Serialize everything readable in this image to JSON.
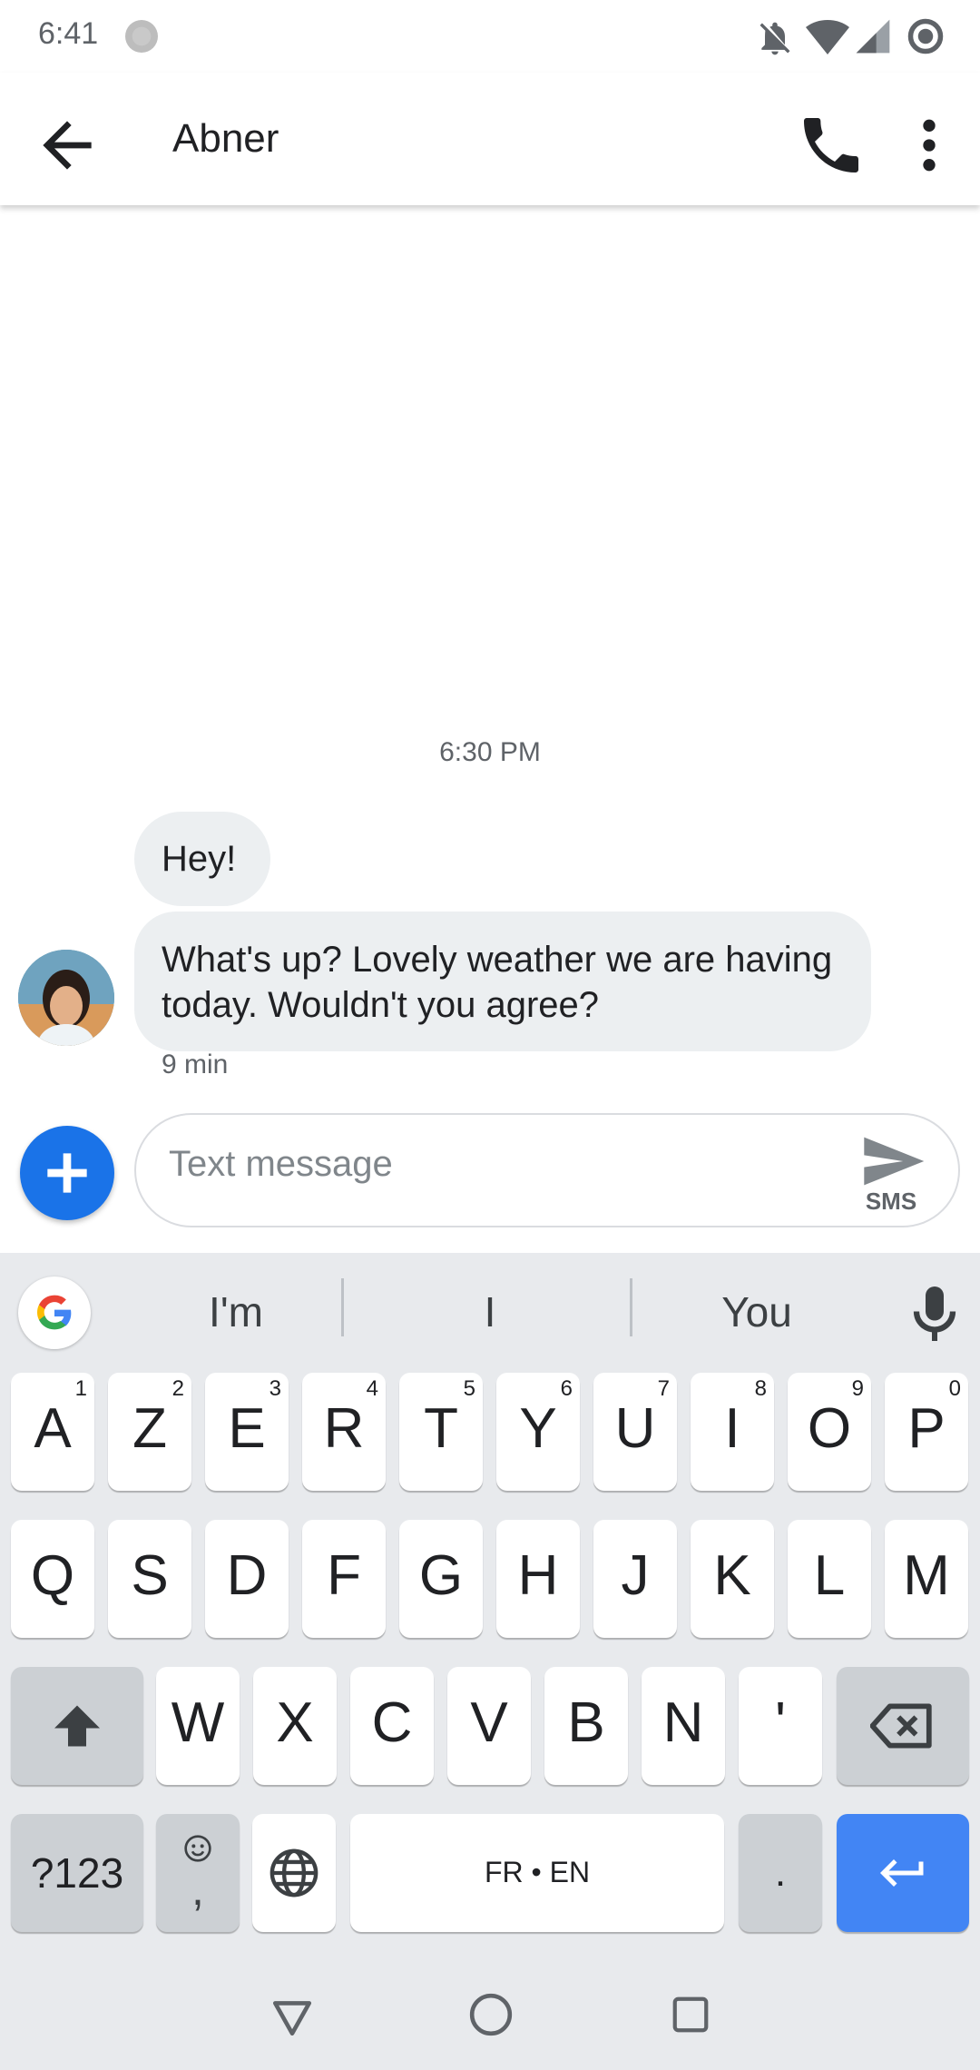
{
  "status_bar": {
    "time": "6:41"
  },
  "app_bar": {
    "contact_name": "Abner"
  },
  "conversation": {
    "timestamp": "6:30 PM",
    "messages": [
      {
        "text": "Hey!"
      },
      {
        "text": "What's up? Lovely weather we are having today. Wouldn't you agree?"
      }
    ],
    "meta": "9 min"
  },
  "compose": {
    "placeholder": "Text message",
    "send_label": "SMS"
  },
  "keyboard": {
    "suggestions": [
      "I'm",
      "I",
      "You"
    ],
    "row1": [
      {
        "label": "A",
        "hint": "1"
      },
      {
        "label": "Z",
        "hint": "2"
      },
      {
        "label": "E",
        "hint": "3"
      },
      {
        "label": "R",
        "hint": "4"
      },
      {
        "label": "T",
        "hint": "5"
      },
      {
        "label": "Y",
        "hint": "6"
      },
      {
        "label": "U",
        "hint": "7"
      },
      {
        "label": "I",
        "hint": "8"
      },
      {
        "label": "O",
        "hint": "9"
      },
      {
        "label": "P",
        "hint": "0"
      }
    ],
    "row2": [
      "Q",
      "S",
      "D",
      "F",
      "G",
      "H",
      "J",
      "K",
      "L",
      "M"
    ],
    "row3": [
      "W",
      "X",
      "C",
      "V",
      "B",
      "N",
      "'"
    ],
    "symbols_label": "?123",
    "comma_label": ",",
    "space_label": "FR • EN",
    "period_label": ".",
    "accent_color": "#4285f4"
  },
  "icons": {
    "status": [
      "bell-off-icon",
      "wifi-icon",
      "signal-icon",
      "data-saver-icon"
    ],
    "app_bar": [
      "back-arrow-icon",
      "phone-icon",
      "more-vert-icon"
    ],
    "keyboard": [
      "google-icon",
      "mic-icon",
      "shift-icon",
      "backspace-icon",
      "emoji-icon",
      "globe-icon",
      "enter-icon"
    ],
    "nav": [
      "nav-back-icon",
      "nav-home-icon",
      "nav-recents-icon"
    ]
  }
}
